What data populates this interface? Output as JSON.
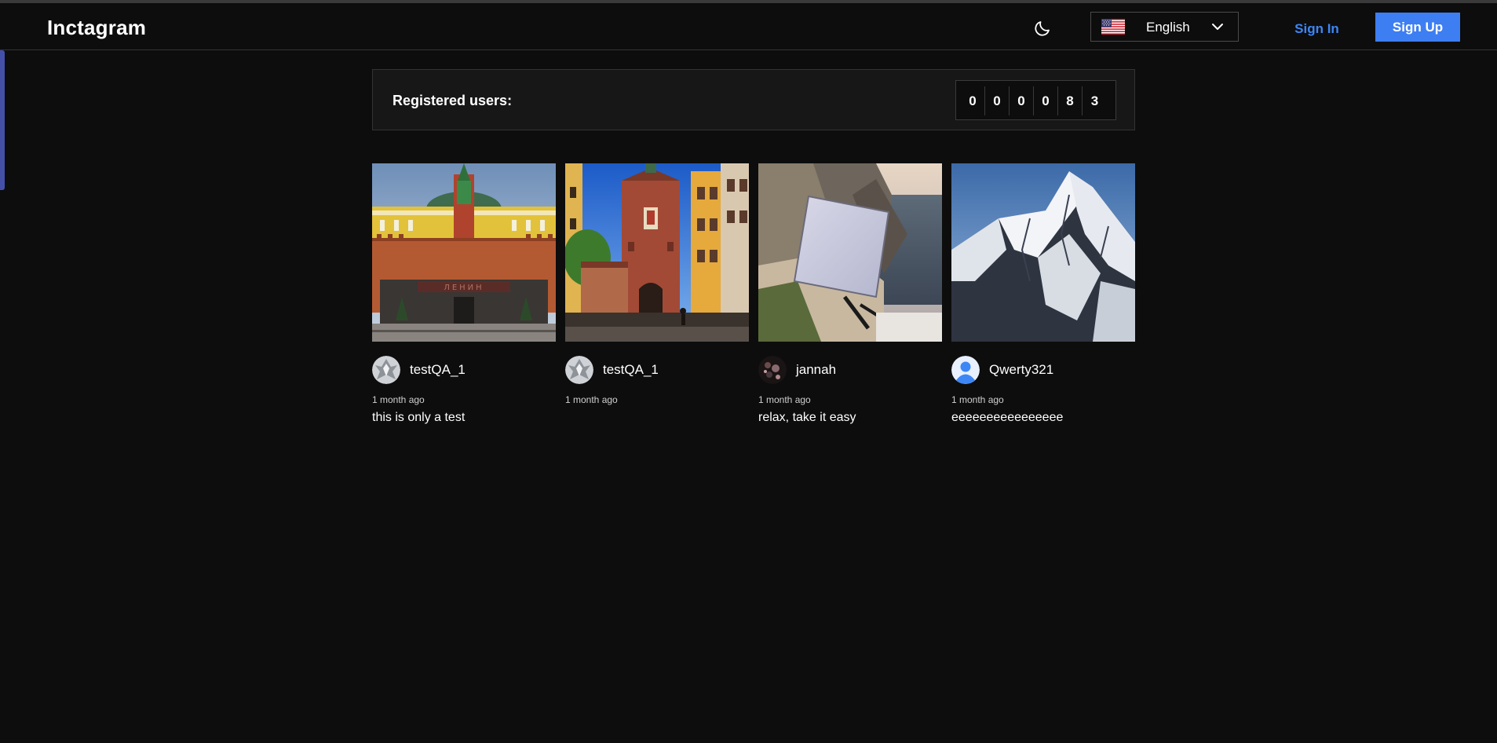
{
  "header": {
    "logo": "Inctagram",
    "theme_icon": "moon-icon",
    "language": {
      "selected": "English",
      "flag_icon": "us-flag-icon"
    },
    "sign_in_label": "Sign In",
    "sign_up_label": "Sign Up"
  },
  "stats": {
    "label": "Registered users:",
    "digits": [
      "0",
      "0",
      "0",
      "0",
      "8",
      "3"
    ]
  },
  "posts": [
    {
      "username": "testQA_1",
      "time": "1 month ago",
      "description": "this is only a test",
      "image": "red-square-mausoleum-photo"
    },
    {
      "username": "testQA_1",
      "time": "1 month ago",
      "description": "",
      "image": "city-gate-tower-photo"
    },
    {
      "username": "jannah",
      "time": "1 month ago",
      "description": "relax, take it easy",
      "image": "satellite-dish-cliff-photo"
    },
    {
      "username": "Qwerty321",
      "time": "1 month ago",
      "description": "eeeeeeeeeeeeeeee",
      "image": "snowy-mountain-photo"
    }
  ],
  "colors": {
    "background": "#0d0d0d",
    "card": "#171717",
    "accent": "#3d7ef2",
    "link": "#3d86f6"
  }
}
